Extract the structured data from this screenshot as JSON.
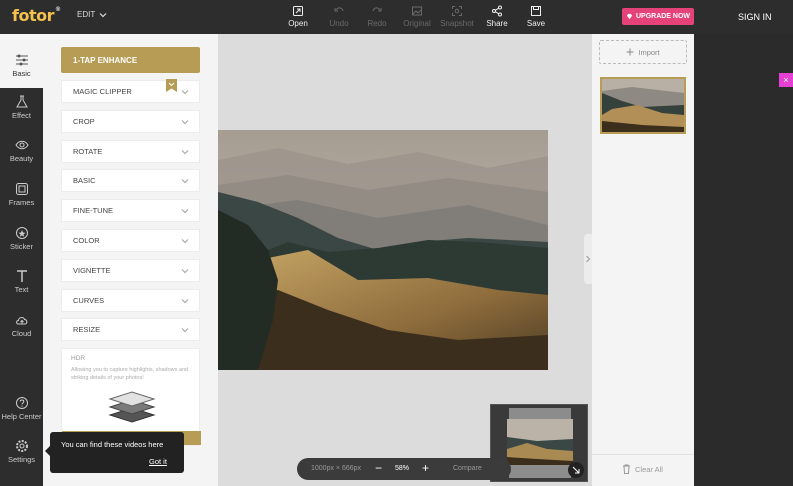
{
  "app": {
    "logo": "fotor",
    "logo_mark": "®",
    "edit_menu": "EDIT"
  },
  "toolbar": {
    "open": "Open",
    "undo": "Undo",
    "redo": "Redo",
    "original": "Original",
    "snapshot": "Snapshot",
    "share": "Share",
    "save": "Save"
  },
  "header": {
    "upgrade": "UPGRADE NOW",
    "signin": "SIGN IN"
  },
  "leftnav": {
    "basic": "Basic",
    "effect": "Effect",
    "beauty": "Beauty",
    "frames": "Frames",
    "sticker": "Sticker",
    "text": "Text",
    "cloud": "Cloud",
    "help": "Help Center",
    "settings": "Settings"
  },
  "panel": {
    "enhance": "1-TAP ENHANCE",
    "items": [
      "MAGIC CLIPPER",
      "CROP",
      "ROTATE",
      "BASIC",
      "FINE-TUNE",
      "COLOR",
      "VIGNETTE",
      "CURVES",
      "RESIZE"
    ],
    "hdr": {
      "title": "HDR",
      "desc": "Allowing you to capture highlights, shadows and striking details of your photos!"
    }
  },
  "canvas": {
    "dimensions": "1000px × 666px",
    "zoom": "58%",
    "compare": "Compare",
    "minus": "−",
    "plus": "+"
  },
  "rightpanel": {
    "import": "Import",
    "clear_all": "Clear All"
  },
  "tooltip": {
    "text": "You can find these videos here",
    "button": "Got it"
  },
  "colors": {
    "accent": "#b69c55",
    "upgrade": "#e6427a",
    "dark": "#2d2d2d",
    "panel": "#f4f4f4",
    "canvas": "#dcdcdc"
  },
  "icons": {
    "open": "open-icon",
    "undo": "undo-icon",
    "redo": "redo-icon",
    "original": "original-icon",
    "snapshot": "snapshot-icon",
    "share": "share-icon",
    "save": "save-icon"
  }
}
